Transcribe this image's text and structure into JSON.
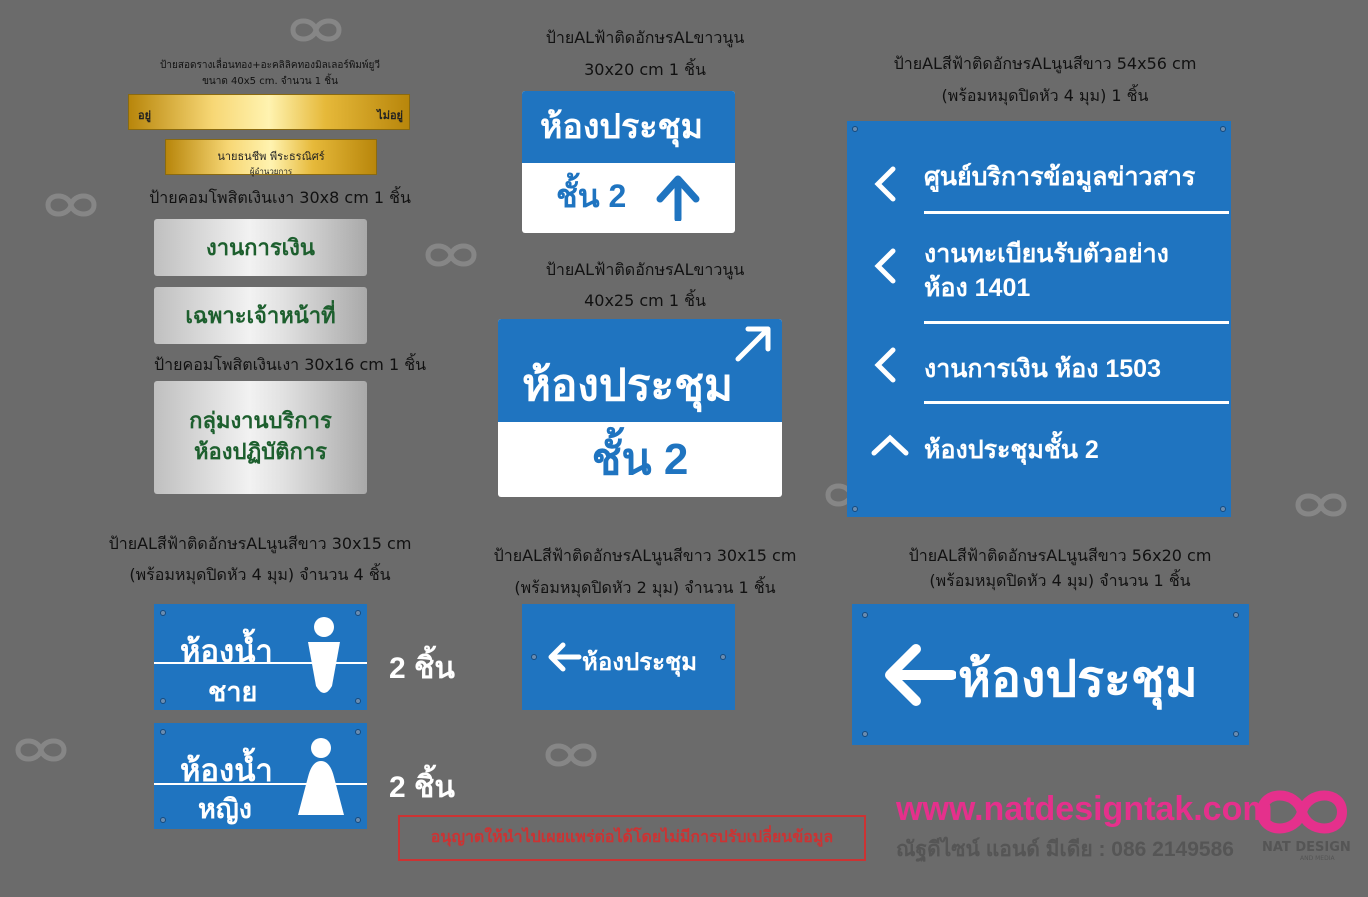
{
  "brass_plate": {
    "caption_line1": "ป้ายสอดรางเลื่อนทอง+อะคลิลิคทองมิลเลอร์พิมพ์ยูวี",
    "caption_line2": "ขนาด 40x5 cm. จำนวน 1 ชิ้น",
    "left_text": "อยู่",
    "right_text": "ไม่อยู่",
    "name_line1": "นายธนชีพ  พีระธรณิศร์",
    "name_line2": "ผู้อำนวยการ"
  },
  "silver_small": {
    "caption": "ป้ายคอมโพสิตเงินเงา 30x8 cm 1 ชิ้น",
    "plate1": "งานการเงิน",
    "plate2": "เฉพาะเจ้าหน้าที่"
  },
  "silver_large": {
    "caption": "ป้ายคอมโพสิตเงินเงา 30x16 cm 1 ชิ้น",
    "line1": "กลุ่มงานบริการ",
    "line2": "ห้องปฏิบัติการ"
  },
  "sign_30x20": {
    "caption_line1": "ป้ายALฟ้าติดอักษรALขาวนูน",
    "caption_line2": "30x20 cm 1 ชิ้น",
    "top": "ห้องประชุม",
    "bottom": "ชั้น 2"
  },
  "sign_40x25": {
    "caption_line1": "ป้ายALฟ้าติดอักษรALขาวนูน",
    "caption_line2": "40x25 cm 1 ชิ้น",
    "top": "ห้องประชุม",
    "bottom": "ชั้น 2"
  },
  "directory": {
    "caption_line1": "ป้ายALสีฟ้าติดอักษรALนูนสีขาว 54x56 cm",
    "caption_line2": "(พร้อมหมุดปิดหัว 4 มุม)  1 ชิ้น",
    "items": [
      {
        "line1": "ศูนย์บริการข้อมูลข่าวสาร",
        "line2": ""
      },
      {
        "line1": "งานทะเบียนรับตัวอย่าง",
        "line2": "ห้อง 1401"
      },
      {
        "line1": "งานการเงิน ห้อง 1503",
        "line2": ""
      },
      {
        "line1": "ห้องประชุมชั้น 2",
        "line2": ""
      }
    ]
  },
  "restroom": {
    "caption_line1": "ป้ายALสีฟ้าติดอักษรALนูนสีขาว 30x15 cm",
    "caption_line2": "(พร้อมหมุดปิดหัว 4 มุม) จำนวน 4 ชิ้น",
    "male_line1": "ห้องน้ำ",
    "male_line2": "ชาย",
    "female_line1": "ห้องน้ำ",
    "female_line2": "หญิง",
    "male_count": "2 ชิ้น",
    "female_count": "2 ชิ้น"
  },
  "small_arrow_sign": {
    "caption_line1": "ป้ายALสีฟ้าติดอักษรALนูนสีขาว 30x15 cm",
    "caption_line2": "(พร้อมหมุดปิดหัว 2 มุม) จำนวน 1 ชิ้น",
    "text": "ห้องประชุม"
  },
  "large_arrow_sign": {
    "caption_line1": "ป้ายALสีฟ้าติดอักษรALนูนสีขาว 56x20 cm",
    "caption_line2": "(พร้อมหมุดปิดหัว 4 มุม) จำนวน 1 ชิ้น",
    "text": "ห้องประชุม"
  },
  "footer": {
    "notice": "อนุญาตให้นำไปเผยแพร่ต่อได้โดยไม่มีการปรับเปลี่ยนข้อมูล",
    "url": "www.natdesigntak.com",
    "company": "ณัฐดีไซน์ แอนด์ มีเดีย : 086 2149586",
    "logo_text": "NAT DESIGN",
    "logo_sub": "AND MEDIA"
  },
  "colors": {
    "background": "#6b6b6b",
    "sign_blue": "#1f74c0",
    "silver_text": "#1d5f2e",
    "brand_pink": "#e5308c"
  }
}
